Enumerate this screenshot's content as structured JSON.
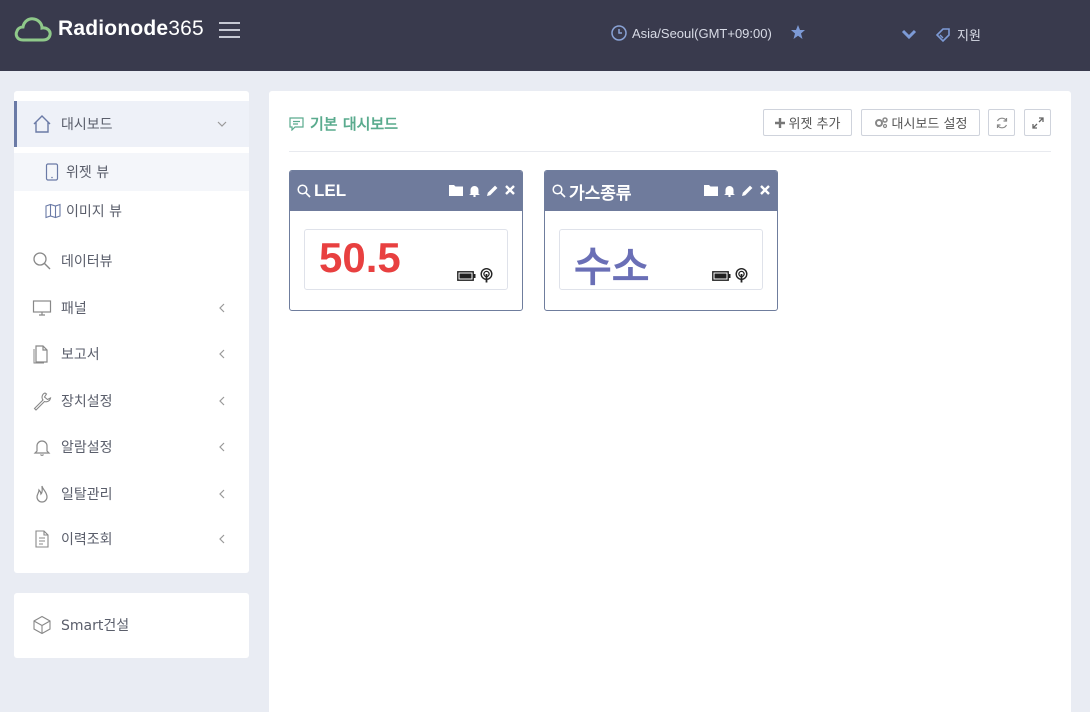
{
  "brand": {
    "name": "Radionode",
    "suffix": "365",
    "accent_color": "#5aab8e"
  },
  "header": {
    "timezone": "Asia/Seoul(GMT+09:00)",
    "support_label": "지원"
  },
  "sidebar": {
    "items": [
      {
        "label": "대시보드",
        "icon": "home-icon"
      },
      {
        "label": "위젯 뷰",
        "icon": "tablet-icon"
      },
      {
        "label": "이미지 뷰",
        "icon": "map-icon"
      },
      {
        "label": "데이터뷰",
        "icon": "search-icon"
      },
      {
        "label": "패널",
        "icon": "monitor-icon"
      },
      {
        "label": "보고서",
        "icon": "document-icon"
      },
      {
        "label": "장치설정",
        "icon": "wrench-icon"
      },
      {
        "label": "알람설정",
        "icon": "bell-icon"
      },
      {
        "label": "일탈관리",
        "icon": "flame-icon"
      },
      {
        "label": "이력조회",
        "icon": "file-list-icon"
      }
    ],
    "extra": {
      "label": "Smart건설",
      "icon": "cube-icon"
    }
  },
  "main": {
    "title": "기본 대시보드",
    "add_widget_label": "위젯 추가",
    "dashboard_settings_label": "대시보드 설정"
  },
  "widgets": [
    {
      "title": "LEL",
      "value": "50.5",
      "value_color": "#e84040"
    },
    {
      "title": "가스종류",
      "value": "수소",
      "value_color": "#6a6fb6"
    }
  ]
}
